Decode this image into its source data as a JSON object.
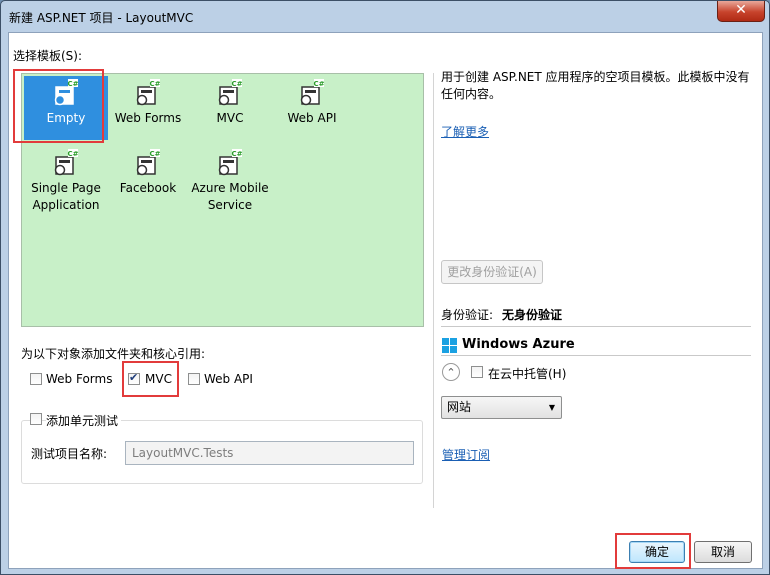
{
  "window": {
    "title": "新建 ASP.NET 项目 - LayoutMVC",
    "close_glyph": "✕"
  },
  "template_section": {
    "label": "选择模板(S):",
    "templates": [
      {
        "label": "Empty",
        "selected": true
      },
      {
        "label": "Web Forms",
        "selected": false
      },
      {
        "label": "MVC",
        "selected": false
      },
      {
        "label": "Web API",
        "selected": false
      },
      {
        "label": "Single Page\nApplication",
        "selected": false
      },
      {
        "label": "Facebook",
        "selected": false
      },
      {
        "label": "Azure Mobile\nService",
        "selected": false
      }
    ],
    "icon_badge": "C#"
  },
  "description": {
    "text": "用于创建 ASP.NET 应用程序的空项目模板。此模板中没有任何内容。",
    "learn_more": "了解更多"
  },
  "auth": {
    "change_button": "更改身份验证(A)",
    "label": "身份验证:",
    "value": "无身份验证"
  },
  "azure": {
    "title": "Windows Azure",
    "collapse_glyph": "⌃",
    "host_in_cloud": {
      "label": "在云中托管(H)",
      "checked": false
    },
    "site_type": {
      "selected": "网站"
    },
    "manage_link": "管理订阅"
  },
  "references": {
    "label": "为以下对象添加文件夹和核心引用:",
    "web_forms": {
      "label": "Web Forms",
      "checked": false
    },
    "mvc": {
      "label": "MVC",
      "checked": true
    },
    "web_api": {
      "label": "Web API",
      "checked": false
    }
  },
  "unit_test": {
    "label": "添加单元测试",
    "checked": false,
    "project_name_label": "测试项目名称:",
    "project_name_value": "LayoutMVC.Tests"
  },
  "buttons": {
    "ok": "确定",
    "cancel": "取消"
  },
  "colors": {
    "template_panel": "#c8f0c8",
    "selection": "#2f8fdf",
    "highlight_box": "#e23b3b"
  }
}
